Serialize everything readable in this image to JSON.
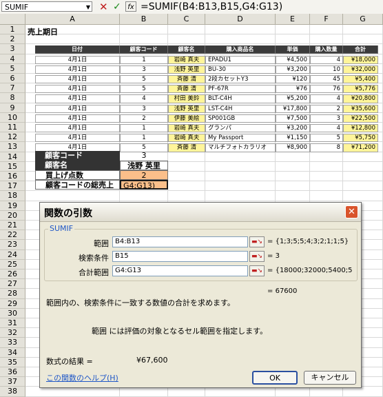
{
  "formula_bar": {
    "name_box": "SUMIF",
    "cancel_icon": "x-icon",
    "enter_icon": "check-icon",
    "fx_label": "fx",
    "formula": "=SUMIF(B4:B13,B15,G4:G13)"
  },
  "columns": [
    "A",
    "B",
    "C",
    "D",
    "E",
    "F",
    "G"
  ],
  "rows": [
    "1",
    "2",
    "3",
    "4",
    "5",
    "6",
    "7",
    "8",
    "9",
    "10",
    "11",
    "12",
    "13",
    "14",
    "15",
    "16",
    "17",
    "18",
    "19",
    "20",
    "21",
    "22",
    "23",
    "24",
    "25",
    "26",
    "27",
    "28",
    "29",
    "30",
    "31",
    "32",
    "33",
    "34",
    "35",
    "36",
    "37",
    "38"
  ],
  "sheet": {
    "title": "売上期日",
    "headers": [
      "日付",
      "顧客コード",
      "顧客名",
      "購入商品名",
      "単価",
      "購入数量",
      "合計"
    ],
    "data": [
      {
        "date": "4月1日",
        "code": "1",
        "name": "岩崎 真夫",
        "item": "EPADU1",
        "price": "¥4,500",
        "qty": "4",
        "total": "¥18,000"
      },
      {
        "date": "4月1日",
        "code": "3",
        "name": "浅野 英里",
        "item": "BU-30",
        "price": "¥3,200",
        "qty": "10",
        "total": "¥32,000"
      },
      {
        "date": "4月1日",
        "code": "5",
        "name": "斉藤 清",
        "item": "2段カセットY3",
        "price": "¥120",
        "qty": "45",
        "total": "¥5,400"
      },
      {
        "date": "4月1日",
        "code": "5",
        "name": "斉藤 清",
        "item": "PF-67R",
        "price": "¥76",
        "qty": "76",
        "total": "¥5,776"
      },
      {
        "date": "4月1日",
        "code": "4",
        "name": "村田 美鈴",
        "item": "BLT-C4H",
        "price": "¥5,200",
        "qty": "4",
        "total": "¥20,800"
      },
      {
        "date": "4月1日",
        "code": "3",
        "name": "浅野 英里",
        "item": "LST-C4H",
        "price": "¥17,800",
        "qty": "2",
        "total": "¥35,600"
      },
      {
        "date": "4月1日",
        "code": "2",
        "name": "伊藤 美絵",
        "item": "SP001GB",
        "price": "¥7,500",
        "qty": "3",
        "total": "¥22,500"
      },
      {
        "date": "4月1日",
        "code": "1",
        "name": "岩崎 真夫",
        "item": "グランパ",
        "price": "¥3,200",
        "qty": "4",
        "total": "¥12,800"
      },
      {
        "date": "4月1日",
        "code": "1",
        "name": "岩崎 真夫",
        "item": "My Passport",
        "price": "¥1,150",
        "qty": "5",
        "total": "¥5,750"
      },
      {
        "date": "4月1日",
        "code": "5",
        "name": "斉藤 清",
        "item": "マルチフォトカラリオ",
        "price": "¥8,900",
        "qty": "8",
        "total": "¥71,200"
      }
    ],
    "summary": {
      "code_label": "顧客コード",
      "code_value": "3",
      "name_label": "顧客名",
      "name_value": "浅野 英里",
      "count_label": "買上げ点数",
      "count_value": "2",
      "total_label": "顧客コードの総売上",
      "total_value": "G4:G13)"
    }
  },
  "dialog": {
    "title": "関数の引数",
    "close_icon": "close-icon",
    "function_name": "SUMIF",
    "args": [
      {
        "label": "範囲",
        "value": "B4:B13",
        "result": "{1;3;5;5;4;3;2;1;1;5}"
      },
      {
        "label": "検索条件",
        "value": "B15",
        "result": "3"
      },
      {
        "label": "合計範囲",
        "value": "G4:G13",
        "result": "{18000;32000;5400;5"
      }
    ],
    "collapse_icon": "range-select-icon",
    "equals": "=",
    "overall_result": "67600",
    "description": "範囲内の、検索条件に一致する数値の合計を求めます。",
    "arg_help": "範囲 には評価の対象となるセル範囲を指定します。",
    "formula_result_label": "数式の結果 =",
    "formula_result_value": "¥67,600",
    "help_link": "この関数のヘルプ(H)",
    "ok_label": "OK",
    "cancel_label": "キャンセル"
  },
  "colors": {
    "header_dark": "#3b3b3b",
    "highlight_yellow": "#fff59a",
    "highlight_orange": "#fbbf8a",
    "dialog_bg": "#ece9d8",
    "close_red": "#d9542b",
    "link_blue": "#1f57c7"
  }
}
